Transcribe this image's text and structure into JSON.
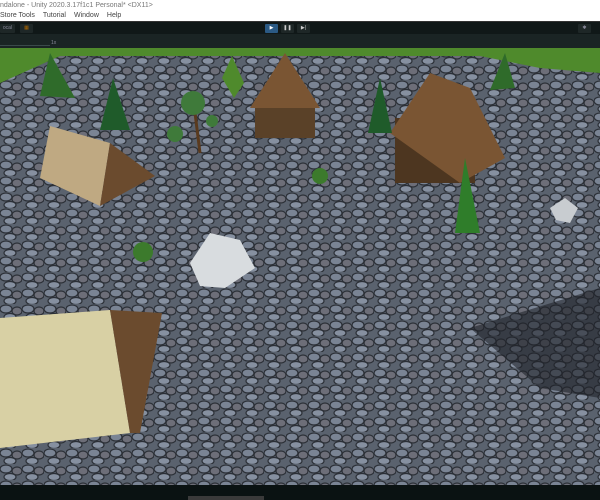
{
  "window": {
    "title": "ndalone - Unity 2020.3.17f1c1 Personal* <DX11>"
  },
  "menu": [
    "Store Tools",
    "Tutorial",
    "Window",
    "Help"
  ],
  "toolbar": {
    "pivot_label": "ocal",
    "play_icon": "play-icon",
    "pause_icon": "pause-icon",
    "step_icon": "step-icon",
    "settings_icon": "gear-icon"
  },
  "scene": {
    "scale_label": "1x"
  }
}
